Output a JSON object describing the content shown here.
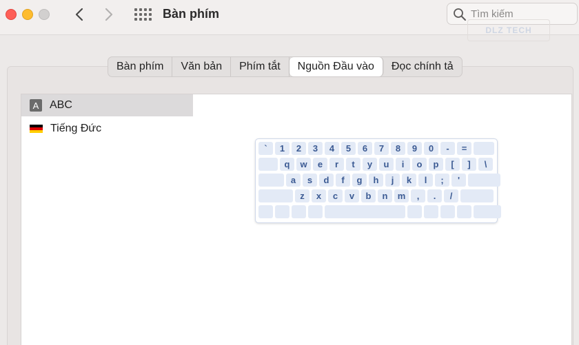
{
  "window": {
    "title": "Bàn phím",
    "search_placeholder": "Tìm kiếm",
    "watermark": "DLZ TECH"
  },
  "tabs": [
    {
      "label": "Bàn phím",
      "active": false
    },
    {
      "label": "Văn bản",
      "active": false
    },
    {
      "label": "Phím tắt",
      "active": false
    },
    {
      "label": "Nguồn Đầu vào",
      "active": true
    },
    {
      "label": "Đọc chính tả",
      "active": false
    }
  ],
  "input_sources": [
    {
      "label": "ABC",
      "icon": "abc-icon",
      "selected": true
    },
    {
      "label": "Tiếng Đức",
      "icon": "german-flag-icon",
      "selected": false
    }
  ],
  "keyboard": {
    "row1": [
      "`",
      "1",
      "2",
      "3",
      "4",
      "5",
      "6",
      "7",
      "8",
      "9",
      "0",
      "-",
      "="
    ],
    "row2": [
      "q",
      "w",
      "e",
      "r",
      "t",
      "y",
      "u",
      "i",
      "o",
      "p",
      "[",
      "]",
      "\\"
    ],
    "row3": [
      "a",
      "s",
      "d",
      "f",
      "g",
      "h",
      "j",
      "k",
      "l",
      ";",
      "'"
    ],
    "row4": [
      "z",
      "x",
      "c",
      "v",
      "b",
      "n",
      "m",
      ",",
      ".",
      "/"
    ]
  },
  "colors": {
    "key_fill": "#e3eaf6",
    "key_text": "#3b5a93",
    "flag": [
      "#000000",
      "#dd0000",
      "#ffce00"
    ]
  }
}
